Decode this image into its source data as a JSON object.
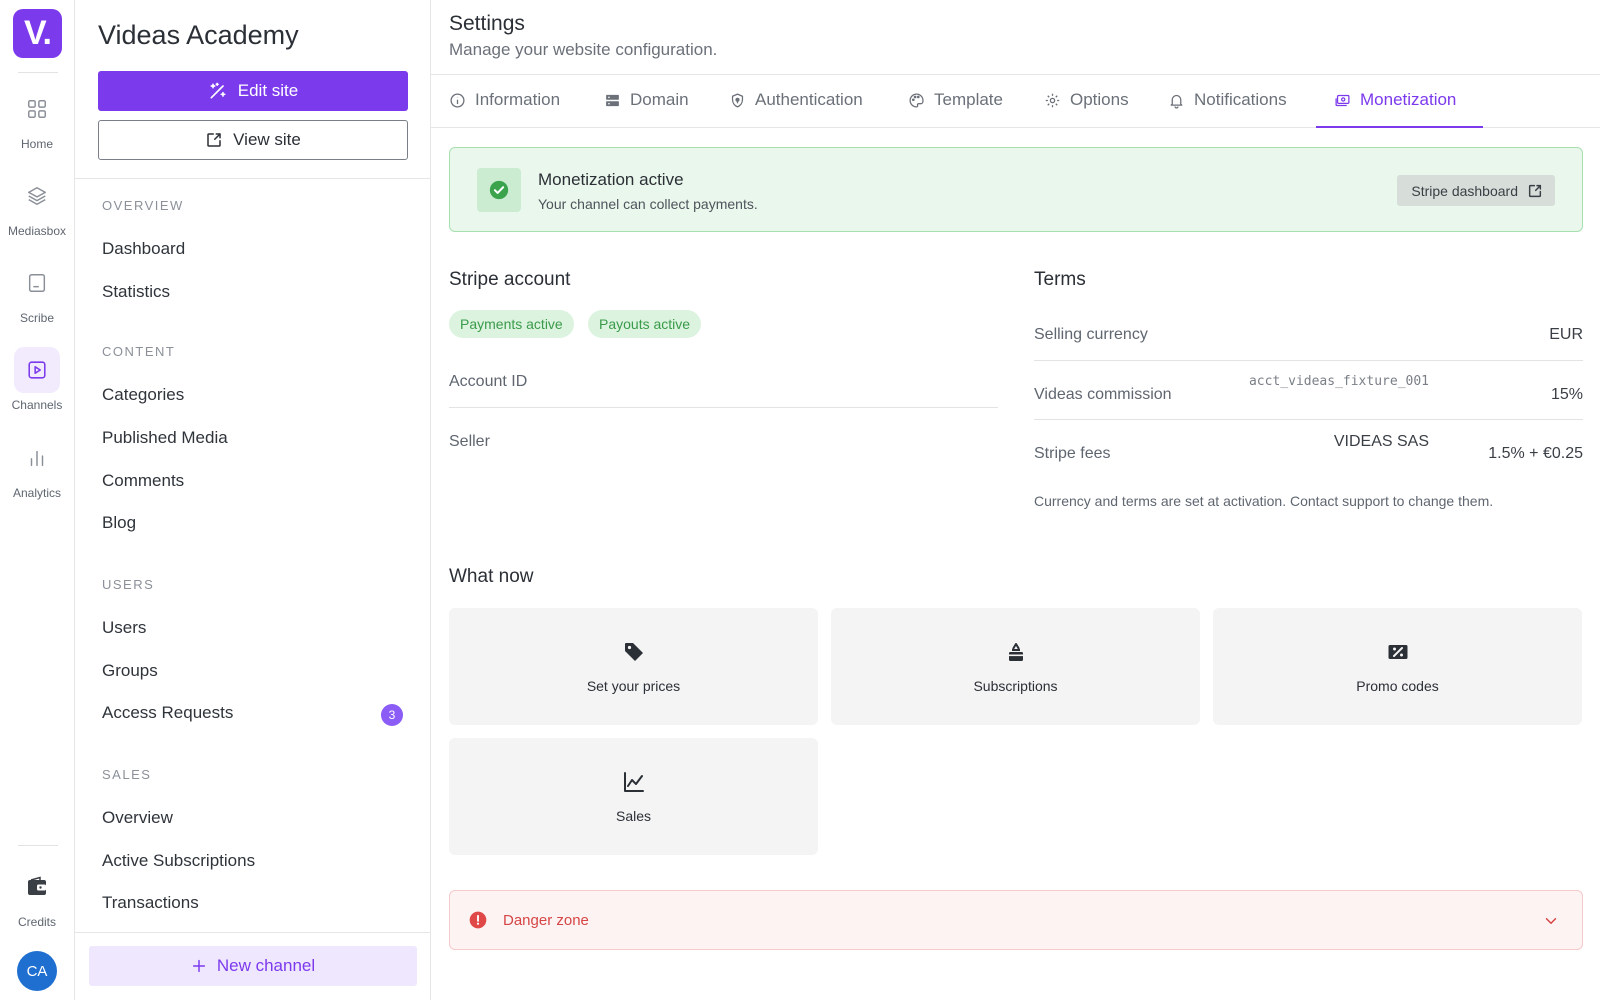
{
  "rail": {
    "logo": "V.",
    "items": [
      {
        "label": "Home",
        "icon": "grid-icon"
      },
      {
        "label": "Mediasbox",
        "icon": "layers-icon"
      },
      {
        "label": "Scribe",
        "icon": "document-icon"
      },
      {
        "label": "Channels",
        "icon": "play-square-icon",
        "active": true
      },
      {
        "label": "Analytics",
        "icon": "bar-chart-icon"
      }
    ],
    "credits": "Credits",
    "avatar": "CA"
  },
  "sidebar": {
    "site_title": "Videas Academy",
    "edit_site": "Edit site",
    "view_site": "View site",
    "sections": {
      "overview": "OVERVIEW",
      "content": "CONTENT",
      "users": "USERS",
      "sales": "SALES"
    },
    "overview_items": [
      "Dashboard",
      "Statistics"
    ],
    "content_items": [
      "Categories",
      "Published Media",
      "Comments",
      "Blog"
    ],
    "users_items": [
      "Users",
      "Groups",
      "Access Requests"
    ],
    "access_requests_count": "3",
    "sales_items": [
      "Overview",
      "Active Subscriptions",
      "Transactions"
    ],
    "new_channel": "New channel"
  },
  "header": {
    "title": "Settings",
    "subtitle": "Manage your website configuration."
  },
  "tabs": [
    {
      "label": "Information",
      "icon": "info-icon"
    },
    {
      "label": "Domain",
      "icon": "server-icon"
    },
    {
      "label": "Authentication",
      "icon": "shield-icon"
    },
    {
      "label": "Template",
      "icon": "palette-icon"
    },
    {
      "label": "Options",
      "icon": "gear-icon"
    },
    {
      "label": "Notifications",
      "icon": "bell-icon"
    },
    {
      "label": "Monetization",
      "icon": "money-icon",
      "active": true
    }
  ],
  "banner": {
    "title": "Monetization active",
    "subtitle": "Your channel can collect payments.",
    "button": "Stripe dashboard"
  },
  "stripe": {
    "heading": "Stripe account",
    "pills": [
      "Payments active",
      "Payouts active"
    ],
    "rows": [
      {
        "label": "Account ID",
        "value": "acct_videas_fixture_001"
      },
      {
        "label": "Seller",
        "value": "VIDEAS SAS"
      }
    ]
  },
  "terms": {
    "heading": "Terms",
    "rows": [
      {
        "label": "Selling currency",
        "value": "EUR"
      },
      {
        "label": "Videas commission",
        "value": "15%"
      },
      {
        "label": "Stripe fees",
        "value": "1.5% + €0.25"
      }
    ],
    "note": "Currency and terms are set at activation. Contact support to change them."
  },
  "what_now": {
    "heading": "What now",
    "cards": [
      {
        "label": "Set your prices",
        "icon": "tag-icon"
      },
      {
        "label": "Subscriptions",
        "icon": "subscriptions-icon"
      },
      {
        "label": "Promo codes",
        "icon": "percent-ticket-icon"
      },
      {
        "label": "Sales",
        "icon": "line-chart-icon"
      }
    ]
  },
  "danger": {
    "label": "Danger zone"
  },
  "colors": {
    "accent": "#7c3aed",
    "success_bg": "#eaf7ec",
    "danger": "#d64545"
  }
}
